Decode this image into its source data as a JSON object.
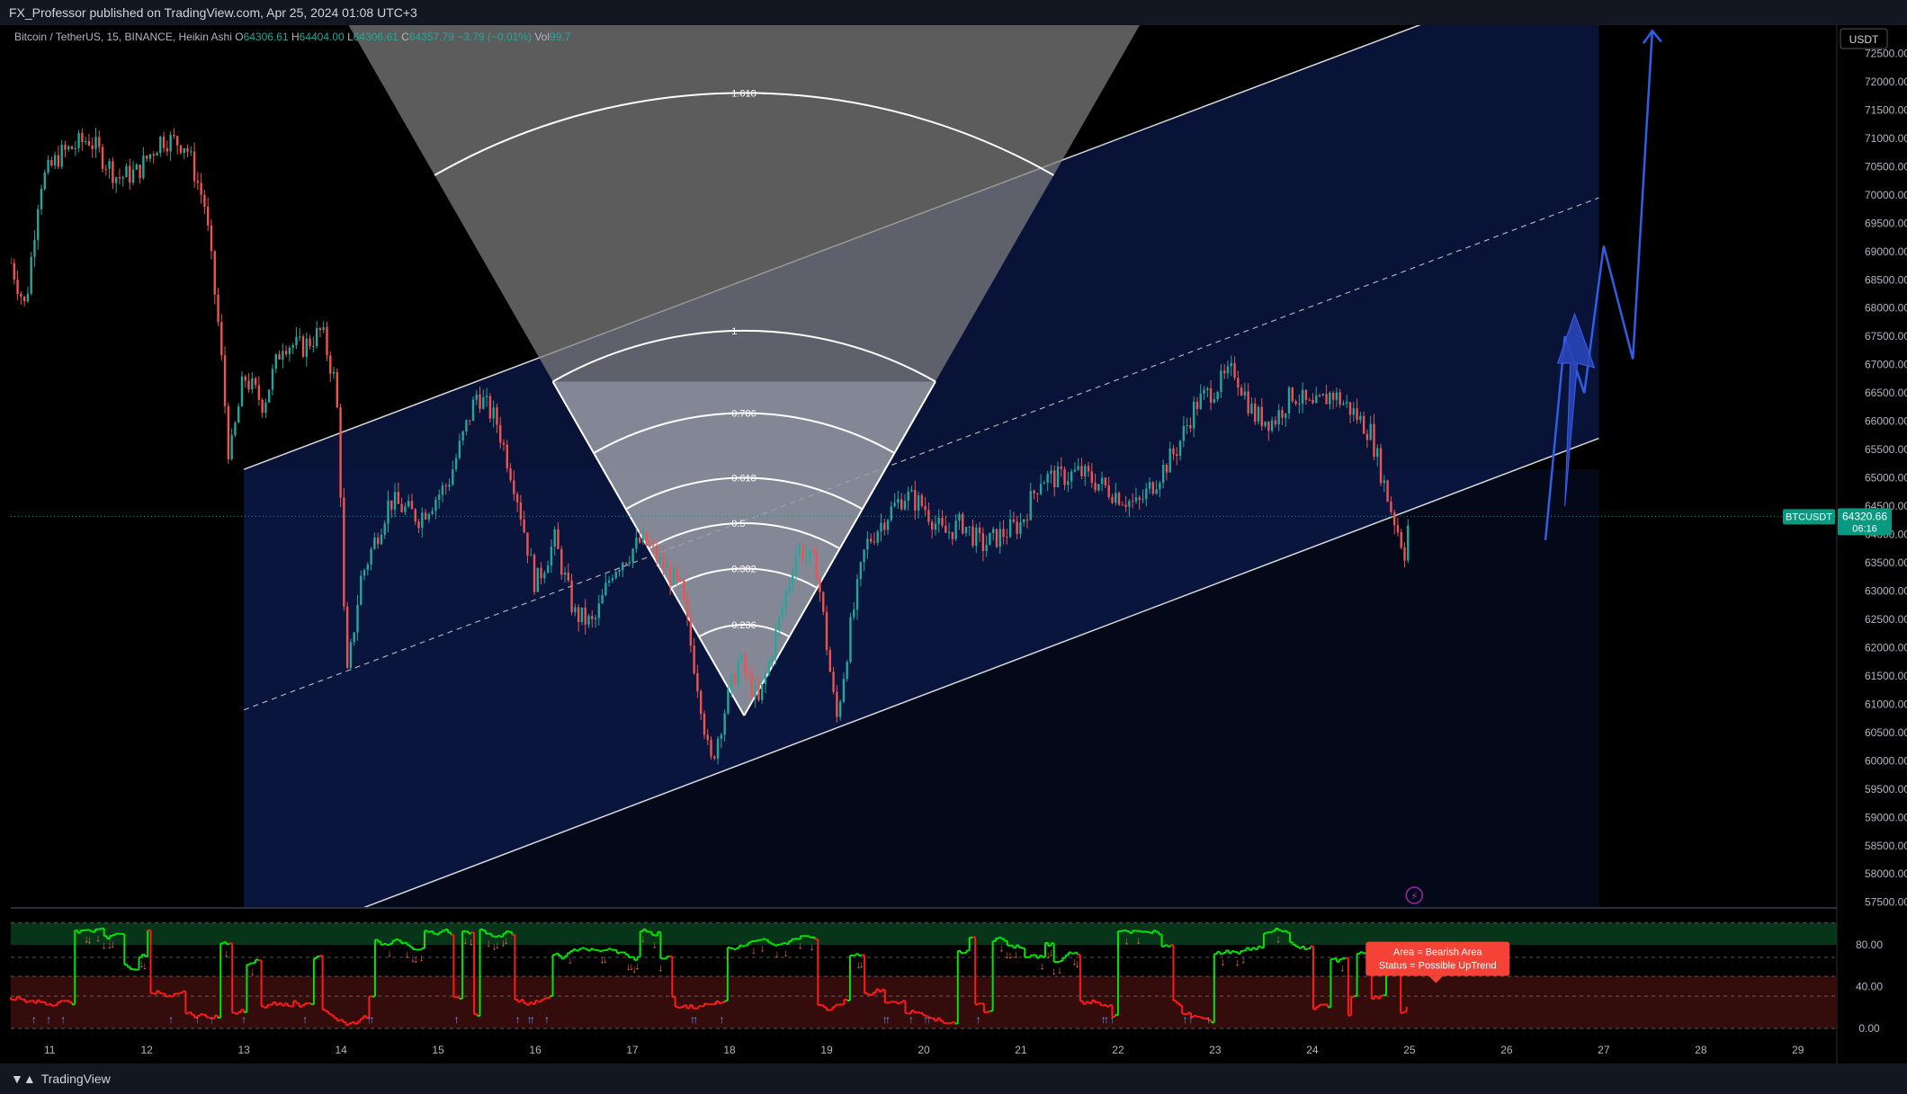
{
  "header": {
    "publisher": "FX_Professor published on TradingView.com, Apr 25, 2024 01:08 UTC+3"
  },
  "legend": {
    "symbol": "Bitcoin / TetherUS, 15, BINANCE, Heikin Ashi",
    "open_label": "O",
    "open": "64306.61",
    "high_label": "H",
    "high": "64404.00",
    "low_label": "L",
    "low": "64306.61",
    "close_label": "C",
    "close": "64357.79",
    "change": "−3.79 (−0.01%)",
    "vol_label": "Vol",
    "vol": "99.7"
  },
  "footer": {
    "brand": "TradingView"
  },
  "colors": {
    "up": "#26a69a",
    "down": "#ef5350",
    "channel_fill": "#0b1a4a",
    "projection": "#2f5ee8",
    "price_tag": "#089981",
    "rsi_up": "#00e600",
    "rsi_down": "#ff1a1a"
  },
  "chart_data": [
    {
      "type": "candlestick",
      "currency": "USDT",
      "ylim": [
        57400,
        73000
      ],
      "y_ticks": [
        57500,
        58000,
        58500,
        59000,
        59500,
        60000,
        60500,
        61000,
        61500,
        62000,
        62500,
        63000,
        63500,
        64000,
        64500,
        65000,
        65500,
        66000,
        66500,
        67000,
        67500,
        68000,
        68500,
        69000,
        69500,
        70000,
        70500,
        71000,
        71500,
        72000,
        72500
      ],
      "y_tick_labels": [
        "57500.00",
        "58000.00",
        "58500.00",
        "59000.00",
        "59500.00",
        "60000.00",
        "60500.00",
        "61000.00",
        "61500.00",
        "62000.00",
        "62500.00",
        "63000.00",
        "63500.00",
        "64000.00",
        "64500.00",
        "65000.00",
        "65500.00",
        "66000.00",
        "66500.00",
        "67000.00",
        "67500.00",
        "68000.00",
        "68500.00",
        "69000.00",
        "69500.00",
        "70000.00",
        "70500.00",
        "71000.00",
        "71500.00",
        "72000.00",
        "72500.00"
      ],
      "x_ticks": [
        11,
        12,
        13,
        14,
        15,
        16,
        17,
        18,
        19,
        20,
        21,
        22,
        23,
        24,
        25,
        26,
        27,
        28,
        29
      ],
      "x_tick_labels": [
        "11",
        "12",
        "13",
        "14",
        "15",
        "16",
        "17",
        "18",
        "19",
        "20",
        "21",
        "22",
        "23",
        "24",
        "25",
        "26",
        "27",
        "28",
        "29"
      ],
      "xlim": [
        10.6,
        29.4
      ],
      "price_path": [
        [
          10.6,
          68800
        ],
        [
          10.75,
          68000
        ],
        [
          10.9,
          70200
        ],
        [
          11.1,
          70700
        ],
        [
          11.4,
          71000
        ],
        [
          11.7,
          70300
        ],
        [
          11.9,
          70400
        ],
        [
          12.15,
          71000
        ],
        [
          12.4,
          70900
        ],
        [
          12.6,
          69800
        ],
        [
          12.75,
          67500
        ],
        [
          12.85,
          65300
        ],
        [
          13.0,
          66800
        ],
        [
          13.2,
          66300
        ],
        [
          13.4,
          67400
        ],
        [
          13.6,
          67300
        ],
        [
          13.8,
          67600
        ],
        [
          13.95,
          66600
        ],
        [
          14.0,
          64600
        ],
        [
          14.05,
          61300
        ],
        [
          14.2,
          63200
        ],
        [
          14.5,
          64600
        ],
        [
          14.8,
          64300
        ],
        [
          15.1,
          64900
        ],
        [
          15.4,
          66500
        ],
        [
          15.6,
          66000
        ],
        [
          15.8,
          64800
        ],
        [
          16.0,
          63100
        ],
        [
          16.2,
          63900
        ],
        [
          16.4,
          62600
        ],
        [
          16.6,
          62400
        ],
        [
          16.8,
          63400
        ],
        [
          17.1,
          63900
        ],
        [
          17.3,
          63500
        ],
        [
          17.5,
          63000
        ],
        [
          17.7,
          61100
        ],
        [
          17.8,
          59900
        ],
        [
          17.95,
          60900
        ],
        [
          18.1,
          61800
        ],
        [
          18.3,
          61000
        ],
        [
          18.5,
          62400
        ],
        [
          18.7,
          63800
        ],
        [
          18.9,
          63400
        ],
        [
          19.1,
          60700
        ],
        [
          19.25,
          62400
        ],
        [
          19.4,
          63800
        ],
        [
          19.6,
          64300
        ],
        [
          19.8,
          64700
        ],
        [
          20.0,
          64500
        ],
        [
          20.2,
          64000
        ],
        [
          20.4,
          64200
        ],
        [
          20.6,
          63800
        ],
        [
          20.8,
          64000
        ],
        [
          21.0,
          64200
        ],
        [
          21.2,
          65000
        ],
        [
          21.4,
          65000
        ],
        [
          21.6,
          65100
        ],
        [
          21.8,
          64900
        ],
        [
          22.0,
          64700
        ],
        [
          22.2,
          64500
        ],
        [
          22.4,
          65000
        ],
        [
          22.6,
          65500
        ],
        [
          22.8,
          66300
        ],
        [
          23.0,
          66600
        ],
        [
          23.2,
          66900
        ],
        [
          23.4,
          66100
        ],
        [
          23.6,
          66000
        ],
        [
          23.8,
          66500
        ],
        [
          24.0,
          66200
        ],
        [
          24.2,
          66500
        ],
        [
          24.4,
          66200
        ],
        [
          24.6,
          65800
        ],
        [
          24.8,
          64500
        ],
        [
          24.95,
          63700
        ],
        [
          25.0,
          64350
        ]
      ],
      "last_price": {
        "symbol": "BTCUSDT",
        "price": "64320.66",
        "countdown": "06:16"
      },
      "channel": {
        "x_start": 13.0,
        "x_end": 26.95,
        "lower": [
          [
            13.0,
            56600
          ],
          [
            26.95,
            65700
          ]
        ],
        "upper": [
          [
            13.0,
            65150
          ],
          [
            26.95,
            74200
          ]
        ],
        "mid": [
          [
            13.0,
            60900
          ],
          [
            26.95,
            69950
          ]
        ]
      },
      "projection_path": [
        [
          26.4,
          63900
        ],
        [
          26.6,
          67500
        ],
        [
          26.8,
          66500
        ],
        [
          27.0,
          69100
        ],
        [
          27.3,
          67100
        ],
        [
          27.5,
          72900
        ]
      ],
      "projection_arrow": {
        "base": [
          26.6,
          64500
        ],
        "tip": [
          26.7,
          67900
        ]
      },
      "fib_fan": {
        "apex": [
          18.15,
          60800
        ],
        "levels": [
          "0.236",
          "0.382",
          "0.5",
          "0.618",
          "0.786",
          "1",
          "1.618"
        ],
        "level_values": [
          0.236,
          0.382,
          0.5,
          0.618,
          0.786,
          1,
          1.618
        ]
      }
    },
    {
      "type": "line",
      "indicator": "RSI",
      "ylim": [
        -5,
        105
      ],
      "y_ticks": [
        0,
        40,
        80
      ],
      "y_tick_labels": [
        "0.00",
        "40.00",
        "80.00"
      ],
      "zones": {
        "upper_band": [
          80,
          101
        ],
        "lower_band": [
          0,
          50
        ],
        "dashes": [
          0,
          31,
          50,
          68,
          101
        ]
      },
      "annotation": {
        "line1": "Area = Bearish Area",
        "line2": "Status =  Possible UpTrend"
      }
    }
  ]
}
